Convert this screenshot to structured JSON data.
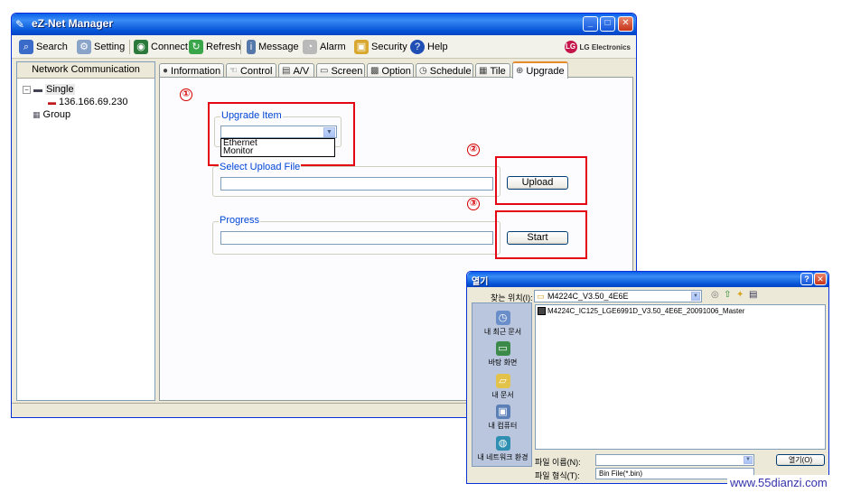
{
  "main_window": {
    "title": "eZ-Net Manager",
    "controls": {
      "minimize": "_",
      "maximize": "□",
      "close": "✕"
    }
  },
  "toolbar": {
    "search": "Search",
    "setting": "Setting",
    "connect": "Connect",
    "refresh": "Refresh",
    "message": "Message",
    "alarm": "Alarm",
    "security": "Security",
    "help": "Help",
    "brand": "LG Electronics"
  },
  "left_panel": {
    "header": "Network Communication",
    "tree": {
      "single": "Single",
      "device_ip": "136.166.69.230",
      "group": "Group"
    }
  },
  "tabs": {
    "information": "Information",
    "control": "Control",
    "av": "A/V",
    "screen": "Screen",
    "option": "Option",
    "schedule": "Schedule",
    "tile": "Tile",
    "upgrade": "Upgrade",
    "active": "Upgrade"
  },
  "upgrade": {
    "step1": "①",
    "step2": "②",
    "step3": "③",
    "upgrade_item_title": "Upgrade Item",
    "upgrade_item_value": "",
    "dropdown_options": [
      "Ethernet",
      "Monitor"
    ],
    "upload_file_title": "Select Upload File",
    "upload_file_value": "",
    "upload_button": "Upload",
    "progress_title": "Progress",
    "progress_fraction": 0,
    "start_button": "Start"
  },
  "open_dialog": {
    "title": "열기",
    "look_in_label": "찾는 위치(I):",
    "look_in_value": "M4224C_V3.50_4E6E",
    "places": [
      "내 최근 문서",
      "바탕 화면",
      "내 문서",
      "내 컴퓨터",
      "내 네트워크 환경"
    ],
    "files": [
      "M4224C_IC125_LGE6991D_V3.50_4E6E_20091006_Master"
    ],
    "filename_label": "파일 이름(N):",
    "filename_value": "",
    "filetype_label": "파일 형식(T):",
    "filetype_value": "Bin File(*.bin)",
    "open_button": "열기(O)"
  },
  "watermark": "www.55dianzi.com",
  "colors": {
    "titlebar_blue": "#0553d6",
    "highlight_red": "#e30613",
    "group_title_blue": "#0046d5",
    "active_tab_orange": "#e68b2c"
  }
}
